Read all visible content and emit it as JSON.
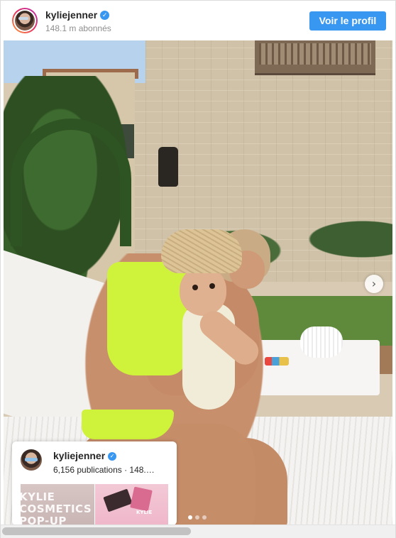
{
  "header": {
    "username": "kyliejenner",
    "verified_icon": "verified-badge-icon",
    "followers": "148.1 m abonnés",
    "profile_button_label": "Voir le profil",
    "button_color": "#3897f0"
  },
  "post": {
    "next_arrow_icon": "chevron-right-icon",
    "next_arrow_glyph": "›",
    "carousel_dots": 3,
    "active_dot": 1
  },
  "hovercard": {
    "username": "kyliejenner",
    "stats": "6,156 publications · 148.…",
    "thumb1_text": "KYLIE COSMETICS POP-UP TOUR",
    "thumb2_text": "KYLIE"
  }
}
